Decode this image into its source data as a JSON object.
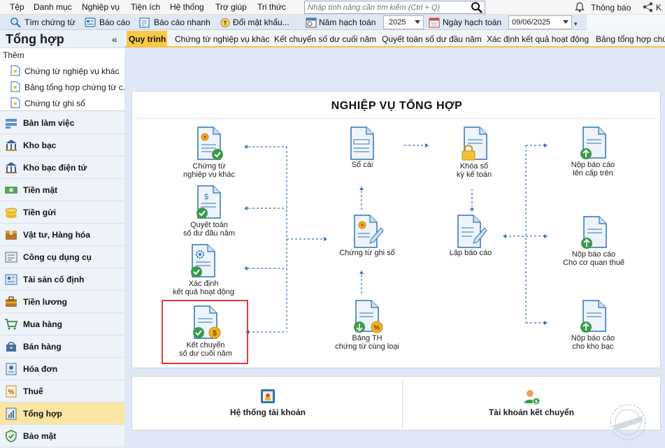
{
  "menubar": {
    "items": [
      "Tệp",
      "Danh mục",
      "Nghiệp vụ",
      "Tiện ích",
      "Hệ thống",
      "Trợ giúp",
      "Tri thức"
    ],
    "search_placeholder": "Nhập tính năng cần tìm kiếm (Ctrl + Q)",
    "notifications": "Thông báo",
    "right_label": "K"
  },
  "toolbar": {
    "find_voucher": "Tìm chứng từ",
    "report": "Báo cáo",
    "quick_report": "Báo cáo nhanh",
    "change_password": "Đổi mật khẩu...",
    "fiscal_year_label": "Năm hạch toán",
    "fiscal_year_value": "2025",
    "posting_date_label": "Ngày hạch toán",
    "posting_date_value": "09/06/2025"
  },
  "sidebar": {
    "title": "Tổng hợp",
    "collapse": "«",
    "add_label": "Thêm",
    "add_items": [
      "Chứng từ nghiệp vụ khác",
      "Bảng tổng hợp chứng từ c...",
      "Chứng từ ghi sổ"
    ],
    "modules": [
      {
        "label": "Bàn làm việc",
        "icon": "desk-icon"
      },
      {
        "label": "Kho bạc",
        "icon": "treasury-icon"
      },
      {
        "label": "Kho bạc điện tử",
        "icon": "e-treasury-icon"
      },
      {
        "label": "Tiền mặt",
        "icon": "cash-icon"
      },
      {
        "label": "Tiền gửi",
        "icon": "deposit-icon"
      },
      {
        "label": "Vật tư, Hàng hóa",
        "icon": "goods-icon"
      },
      {
        "label": "Công cụ dụng cụ",
        "icon": "tools-icon"
      },
      {
        "label": "Tài sản cố định",
        "icon": "fixed-asset-icon"
      },
      {
        "label": "Tiền lương",
        "icon": "salary-icon"
      },
      {
        "label": "Mua hàng",
        "icon": "cart-icon"
      },
      {
        "label": "Bán hàng",
        "icon": "sales-icon"
      },
      {
        "label": "Hóa đơn",
        "icon": "invoice-icon"
      },
      {
        "label": "Thuế",
        "icon": "tax-icon"
      },
      {
        "label": "Tổng hợp",
        "icon": "summary-icon",
        "active": true
      },
      {
        "label": "Bảo mật",
        "icon": "security-icon"
      }
    ]
  },
  "tabs": [
    "Quy trình",
    "Chứng từ nghiệp vụ khác",
    "Kết chuyển số dư cuối năm",
    "Quyết toán số dư đầu năm",
    "Xác định kết quả hoạt động",
    "Bảng tổng hợp chứn"
  ],
  "diagram": {
    "title": "NGHIỆP VỤ TỔNG HỢP",
    "nodes": {
      "ct_khac": [
        "Chứng từ",
        "nghiệp vụ khác"
      ],
      "quyet_toan": [
        "Quyết toán",
        "số dư đầu năm"
      ],
      "xac_dinh": [
        "Xác định",
        "kết quả hoạt động"
      ],
      "ket_chuyen": [
        "Kết chuyển",
        "số dư cuối năm"
      ],
      "so_cai": [
        "Sổ cái"
      ],
      "ct_ghi_so": [
        "Chứng từ ghi sổ"
      ],
      "bang_th": [
        "Bảng TH",
        "chứng từ cùng loại"
      ],
      "khoa_so": [
        "Khóa sổ",
        "kỳ kế toán"
      ],
      "lap_bao_cao": [
        "Lập báo cáo"
      ],
      "nop_cap_tren": [
        "Nộp báo cáo",
        "lên cấp trên"
      ],
      "nop_thue": [
        "Nộp báo cáo",
        "Cho cơ quan thuế"
      ],
      "nop_kho_bac": [
        "Nộp báo cáo",
        "cho kho bạc"
      ]
    }
  },
  "bottom": {
    "accounts": "Hệ thống tài khoản",
    "transfer_accounts": "Tài khoản kết chuyển"
  },
  "colors": {
    "accent": "#f9c846",
    "highlight_border": "#e43b3b",
    "doc_blue": "#2e73b8",
    "check_green": "#3a9a4b",
    "coin_gold": "#f2b41b"
  }
}
